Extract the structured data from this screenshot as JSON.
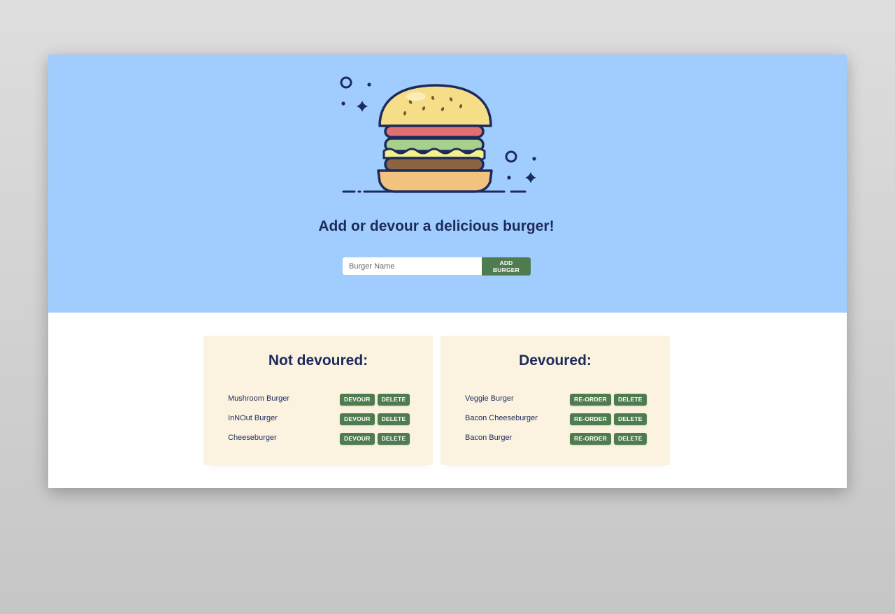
{
  "hero": {
    "title": "Add or devour a delicious burger!"
  },
  "form": {
    "placeholder": "Burger Name",
    "value": "",
    "button_label": "ADD BURGER"
  },
  "not_devoured": {
    "title": "Not devoured:",
    "items": [
      {
        "name": "Mushroom Burger",
        "primary_action": "DEVOUR",
        "secondary_action": "DELETE"
      },
      {
        "name": "InNOut Burger",
        "primary_action": "DEVOUR",
        "secondary_action": "DELETE"
      },
      {
        "name": "Cheeseburger",
        "primary_action": "DEVOUR",
        "secondary_action": "DELETE"
      }
    ]
  },
  "devoured": {
    "title": "Devoured:",
    "items": [
      {
        "name": "Veggie Burger",
        "primary_action": "RE-ORDER",
        "secondary_action": "DELETE"
      },
      {
        "name": "Bacon Cheeseburger",
        "primary_action": "RE-ORDER",
        "secondary_action": "DELETE"
      },
      {
        "name": "Bacon Burger",
        "primary_action": "RE-ORDER",
        "secondary_action": "DELETE"
      }
    ]
  },
  "colors": {
    "hero_background": "#a0cdfd",
    "card_background": "#fbf3e0",
    "button_green": "#4f7c4f",
    "heading_navy": "#1d2a5c"
  },
  "icons": {
    "hero_illustration": "burger-icon"
  }
}
